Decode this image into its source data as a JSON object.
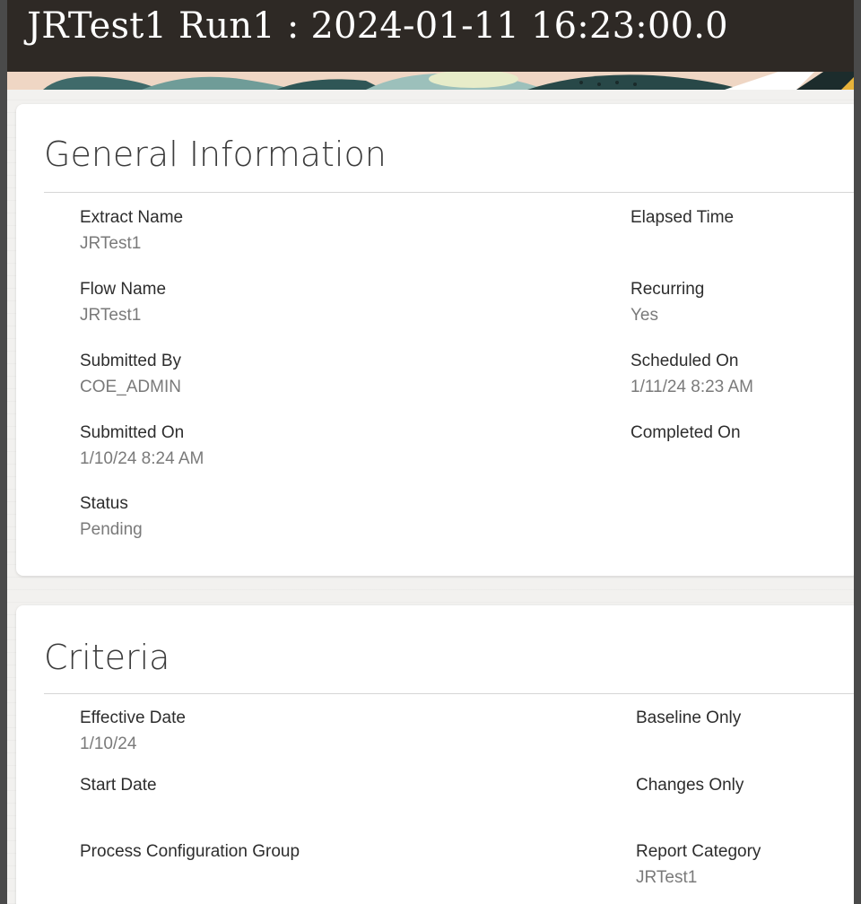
{
  "page": {
    "title": "JRTest1 Run1 : 2024-01-11 16:23:00.0"
  },
  "general_information": {
    "heading": "General Information",
    "left_fields": [
      {
        "label": "Extract Name",
        "value": "JRTest1"
      },
      {
        "label": "Flow Name",
        "value": "JRTest1"
      },
      {
        "label": "Submitted By",
        "value": "COE_ADMIN"
      },
      {
        "label": "Submitted On",
        "value": "1/10/24 8:24 AM"
      },
      {
        "label": "Status",
        "value": "Pending"
      }
    ],
    "right_fields": [
      {
        "label": "Elapsed Time",
        "value": ""
      },
      {
        "label": "Recurring",
        "value": "Yes"
      },
      {
        "label": "Scheduled On",
        "value": "1/11/24 8:23 AM"
      },
      {
        "label": "Completed On",
        "value": ""
      }
    ]
  },
  "criteria": {
    "heading": "Criteria",
    "left_fields": [
      {
        "label": "Effective Date",
        "value": "1/10/24"
      },
      {
        "label": "Start Date",
        "value": ""
      },
      {
        "label": "Process Configuration Group",
        "value": ""
      }
    ],
    "right_fields": [
      {
        "label": "Baseline Only",
        "value": ""
      },
      {
        "label": "Changes Only",
        "value": ""
      },
      {
        "label": "Report Category",
        "value": "JRTest1"
      }
    ]
  },
  "colors": {
    "title_bar": "#2e2925",
    "card_background": "#ffffff",
    "label_text": "#2d2d2d",
    "value_text": "#7a7a7a"
  }
}
